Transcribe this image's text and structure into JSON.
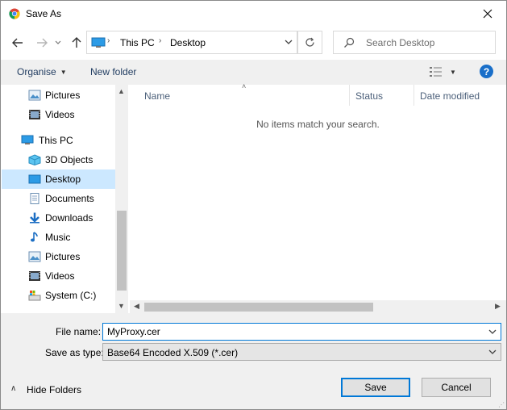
{
  "window": {
    "title": "Save As"
  },
  "address": {
    "crumbs": [
      "This PC",
      "Desktop"
    ]
  },
  "search": {
    "placeholder": "Search Desktop"
  },
  "toolbar": {
    "organise_label": "Organise",
    "new_folder_label": "New folder",
    "help_label": "?"
  },
  "nav": {
    "items": [
      {
        "label": "Pictures",
        "icon": "pictures-icon"
      },
      {
        "label": "Videos",
        "icon": "videos-icon"
      },
      {
        "label": "This PC",
        "icon": "computer-icon"
      },
      {
        "label": "3D Objects",
        "icon": "3d-objects-icon"
      },
      {
        "label": "Desktop",
        "icon": "desktop-icon",
        "selected": true
      },
      {
        "label": "Documents",
        "icon": "documents-icon"
      },
      {
        "label": "Downloads",
        "icon": "downloads-icon"
      },
      {
        "label": "Music",
        "icon": "music-icon"
      },
      {
        "label": "Pictures",
        "icon": "pictures-icon"
      },
      {
        "label": "Videos",
        "icon": "videos-icon"
      },
      {
        "label": "System (C:)",
        "icon": "drive-icon"
      }
    ]
  },
  "filelist": {
    "columns": [
      "Name",
      "Status",
      "Date modified"
    ],
    "empty_message": "No items match your search."
  },
  "form": {
    "file_name_label": "File name:",
    "file_name_value": "MyProxy.cer",
    "save_as_type_label": "Save as type:",
    "save_as_type_value": "Base64 Encoded X.509 (*.cer)"
  },
  "footer": {
    "hide_folders_label": "Hide Folders",
    "save_label": "Save",
    "cancel_label": "Cancel"
  },
  "colors": {
    "accent": "#0078d7",
    "selected_bg": "#cce8ff",
    "panel_bg": "#f0f0f0"
  }
}
